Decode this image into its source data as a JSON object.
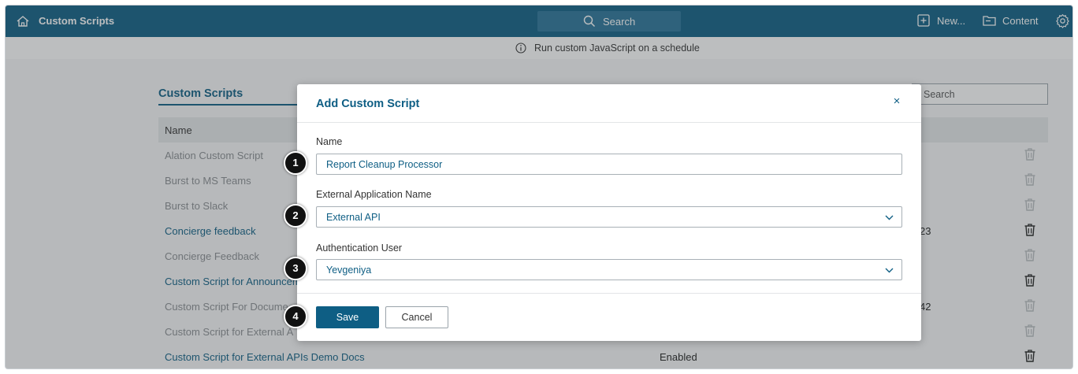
{
  "header": {
    "app_title": "Custom Scripts",
    "search_label": "Search",
    "new_label": "New...",
    "content_label": "Content"
  },
  "info_banner": "Run custom JavaScript on a schedule",
  "background": {
    "tab_label": "Custom Scripts",
    "search_placeholder": "Search",
    "column_name": "Name",
    "rows": [
      {
        "name": "Alation Custom Script",
        "status": "",
        "extra": "",
        "state": "dim"
      },
      {
        "name": "Burst to MS Teams",
        "status": "",
        "extra": "",
        "state": "dim"
      },
      {
        "name": "Burst to Slack",
        "status": "",
        "extra": "",
        "state": "dim"
      },
      {
        "name": "Concierge feedback",
        "status": "",
        "extra": "23",
        "state": "active"
      },
      {
        "name": "Concierge Feedback",
        "status": "",
        "extra": "",
        "state": "dim"
      },
      {
        "name": "Custom Script for Announcem",
        "status": "",
        "extra": "",
        "state": "active"
      },
      {
        "name": "Custom Script For Docume",
        "status": "",
        "extra": "42",
        "state": "dim"
      },
      {
        "name": "Custom Script for External A",
        "status": "",
        "extra": "",
        "state": "dim"
      },
      {
        "name": "Custom Script for External APIs Demo Docs",
        "status": "Enabled",
        "extra": "",
        "state": "active"
      }
    ]
  },
  "modal": {
    "title": "Add Custom Script",
    "name_label": "Name",
    "name_value": "Report Cleanup Processor",
    "ext_app_label": "External Application Name",
    "ext_app_value": "External API",
    "auth_user_label": "Authentication User",
    "auth_user_value": "Yevgeniya",
    "save_label": "Save",
    "cancel_label": "Cancel"
  },
  "markers": [
    "1",
    "2",
    "3",
    "4"
  ],
  "colors": {
    "brand": "#0e5e84",
    "marker": "#111111"
  }
}
